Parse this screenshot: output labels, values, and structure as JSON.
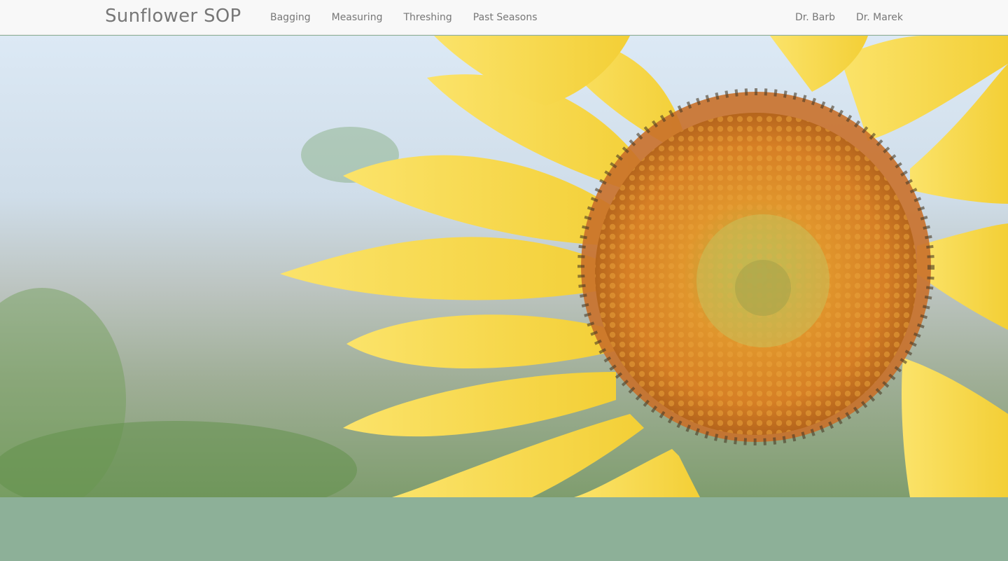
{
  "navbar": {
    "brand": "Sunflower SOP",
    "left_links": [
      {
        "label": "Bagging"
      },
      {
        "label": "Measuring"
      },
      {
        "label": "Threshing"
      },
      {
        "label": "Past Seasons"
      }
    ],
    "right_links": [
      {
        "label": "Dr. Barb"
      },
      {
        "label": "Dr. Marek"
      }
    ]
  },
  "hero": {
    "image": "sunflower-closeup-photo"
  },
  "colors": {
    "navbar_bg": "#f8f8f8",
    "nav_text": "#777777",
    "petal": "#f7d94a",
    "disk": "#d88a2a",
    "footer_band": "#8db098"
  }
}
